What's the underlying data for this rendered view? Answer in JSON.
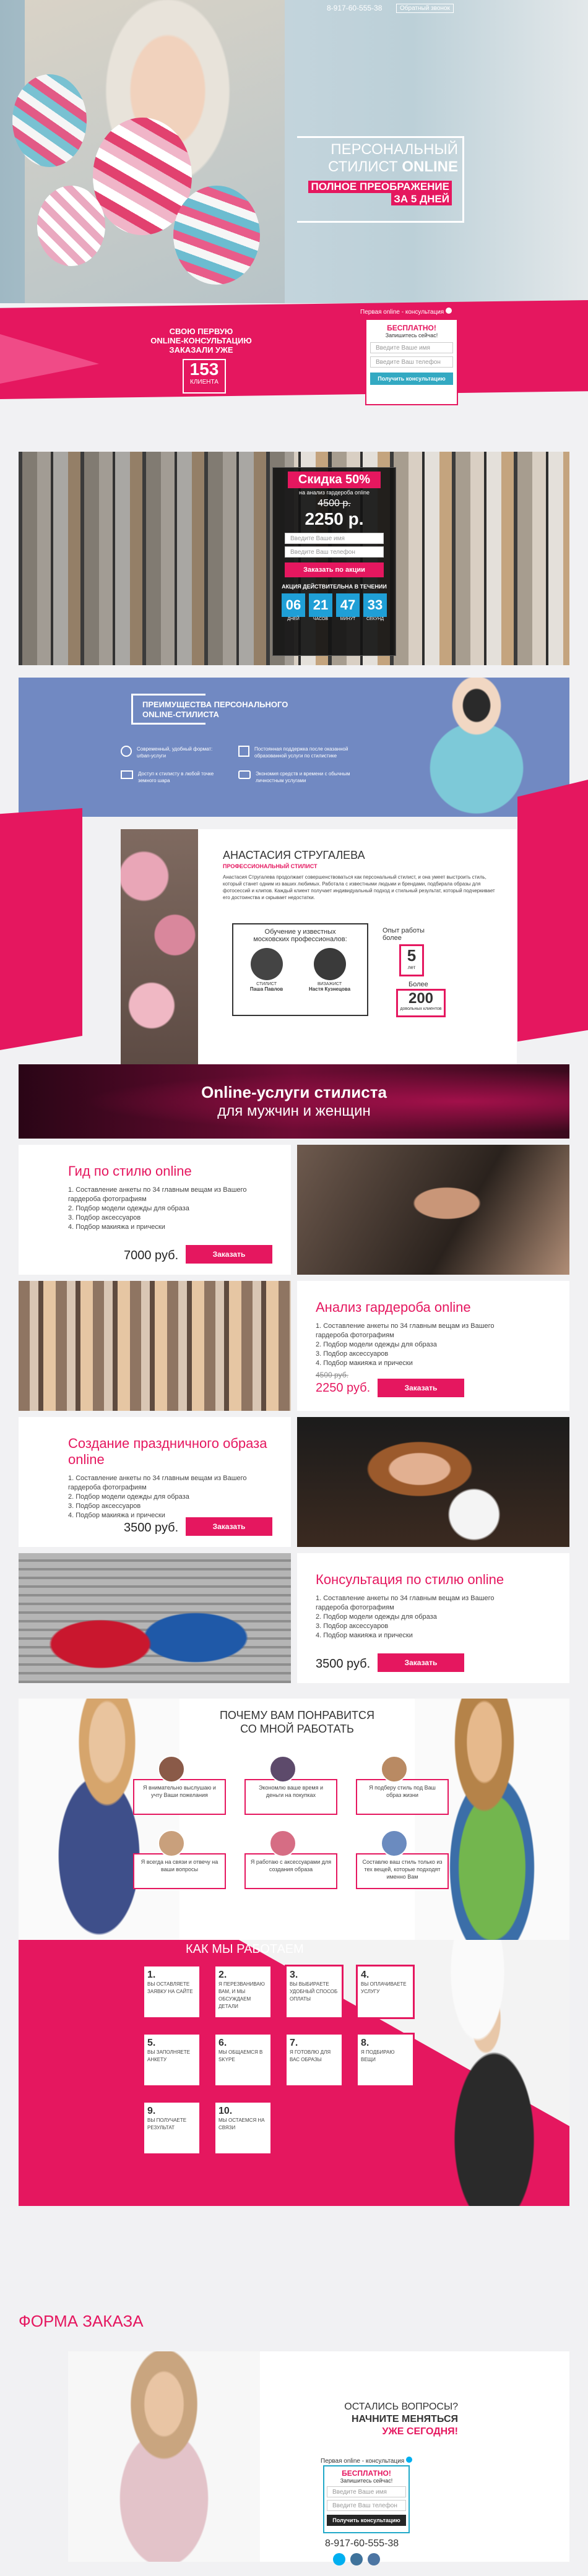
{
  "hero": {
    "phone": "8-917-60-555-38",
    "callback": "Обратный звонок",
    "title_line1": "ПЕРСОНАЛЬНЫЙ",
    "title_line2a": "СТИЛИСТ",
    "title_line2b": "ONLINE",
    "subtitle_line1": "ПОЛНОЕ ПРЕОБРАЖЕНИЕ",
    "subtitle_line2": "ЗА 5 ДНЕЙ",
    "counter_line1": "СВОЮ ПЕРВУЮ",
    "counter_line2": "ONLINE-КОНСУЛЬТАЦИЮ",
    "counter_line3": "ЗАКАЗАЛИ УЖЕ",
    "counter_value": "153",
    "counter_unit": "КЛИЕНТА",
    "form_caption": "Первая online - консультация",
    "form_title": "БЕСПЛАТНО!",
    "form_subtitle": "Запишитесь сейчас!",
    "name_placeholder": "Введите Ваше имя",
    "phone_placeholder": "Введите Ваш телефон",
    "submit": "Получить консультацию"
  },
  "promo": {
    "discount": "Скидка 50%",
    "discount_sub": "на анализ гардероба online",
    "old_price": "4500 р.",
    "new_price": "2250 р.",
    "name_placeholder": "Введите Ваше имя",
    "phone_placeholder": "Введите Ваш телефон",
    "submit": "Заказать по акции",
    "timer_title": "АКЦИЯ ДЕЙСТВИТЕЛЬНА В ТЕЧЕНИИ",
    "timer": [
      {
        "value": "06",
        "label": "ДНЕЙ"
      },
      {
        "value": "21",
        "label": "ЧАСОВ"
      },
      {
        "value": "47",
        "label": "МИНУТ"
      },
      {
        "value": "33",
        "label": "СЕКУНД"
      }
    ]
  },
  "benefits": {
    "title_line1": "ПРЕИМУЩЕСТВА ПЕРСОНАЛЬНОГО",
    "title_line2": "ONLINE-СТИЛИСТА",
    "items": [
      {
        "icon": "skype-icon",
        "text": "Современный, удобный формат: urban-услуги"
      },
      {
        "icon": "clock-icon",
        "text": "Постоянная поддержка после оказанной образованной услуги по стилистике"
      },
      {
        "icon": "laptop-icon",
        "text": "Доступ к стилисту в любой точке земного шара"
      },
      {
        "icon": "wallet-icon",
        "text": "Экономия средств и времени с обычным личностным услугами"
      }
    ]
  },
  "about": {
    "name": "АНАСТАСИЯ СТРУГАЛЕВА",
    "role": "ПРОФЕССИОНАЛЬНЫЙ СТИЛИСТ",
    "bio": "Анастасия Стругалева продолжает совершенствоваться как персональный стилист, и она умеет выстроить стиль, который станет одним из ваших любимых. Работала с известными людьми и брендами, подбирала образы для фотосессий и клипов. Каждый клиент получает индивидуальный подход и стильный результат, который подчеркивает его достоинства и скрывает недостатки.",
    "trained_title": "Обучение у известных",
    "trained_title2": "московских профессионалов:",
    "mentors": [
      {
        "role": "СТИЛИСТ",
        "name": "Паша Павлов"
      },
      {
        "role": "ВИЗАЖИСТ",
        "name": "Настя Кузнецова"
      }
    ],
    "exp_title": "Опыт работы",
    "exp_title2": "более",
    "exp_value": "5",
    "exp_unit": "лет",
    "clients_title": "Более",
    "clients_value": "200",
    "clients_unit": "довольных клиентов"
  },
  "services": {
    "title": "Online-услуги стилиста",
    "subtitle": "для мужчин и женщин",
    "order": "Заказать",
    "items": [
      {
        "title": "Гид по стилю online",
        "price": "7000 руб.",
        "old": ""
      },
      {
        "title": "Анализ гардероба online",
        "price": "2250 руб.",
        "old": "4500 руб."
      },
      {
        "title": "Создание праздничного образа online",
        "price": "3500 руб.",
        "old": ""
      },
      {
        "title": "Консультация по стилю online",
        "price": "3500 руб.",
        "old": ""
      }
    ],
    "desc": "1. Составление анкеты по 34 главным вещам из Вашего гардероба фотографиям\n2. Подбор модели одежды для образа\n3. Подбор аксессуаров\n4. Подбор макияжа и прически"
  },
  "why": {
    "title_line1": "ПОЧЕМУ ВАМ ПОНРАВИТСЯ",
    "title_line2": "СО МНОЙ РАБОТАТЬ",
    "items": [
      "Я внимательно выслушаю и учту Ваши пожелания",
      "Экономлю ваше время и деньги на покупках",
      "Я подберу стиль под Ваш образ жизни",
      "Я всегда на связи и отвечу на ваши вопросы",
      "Я работаю с аксессуарами для создания образа",
      "Составлю ваш стиль только из тех вещей, которые подходят именно Вам"
    ]
  },
  "steps": {
    "title": "КАК МЫ РАБОТАЕМ",
    "items": [
      {
        "n": "1.",
        "text": "ВЫ ОСТАВЛЯЕТЕ ЗАЯВКУ НА САЙТЕ"
      },
      {
        "n": "2.",
        "text": "Я ПЕРЕЗВАНИВАЮ ВАМ, И МЫ ОБСУЖДАЕМ ДЕТАЛИ"
      },
      {
        "n": "3.",
        "text": "ВЫ ВЫБИРАЕТЕ УДОБНЫЙ СПОСОБ ОПЛАТЫ"
      },
      {
        "n": "4.",
        "text": "ВЫ ОПЛАЧИВАЕТЕ УСЛУГУ"
      },
      {
        "n": "5.",
        "text": "ВЫ ЗАПОЛНЯЕТЕ АНКЕТУ"
      },
      {
        "n": "6.",
        "text": "МЫ ОБЩАЕМСЯ В SKYPE"
      },
      {
        "n": "7.",
        "text": "Я ГОТОВЛЮ ДЛЯ ВАС ОБРАЗЫ"
      },
      {
        "n": "8.",
        "text": "Я ПОДБИРАЮ ВЕЩИ"
      },
      {
        "n": "9.",
        "text": "ВЫ ПОЛУЧАЕТЕ РЕЗУЛЬТАТ"
      },
      {
        "n": "10.",
        "text": "МЫ ОСТАЕМСЯ НА СВЯЗИ"
      }
    ]
  },
  "order": {
    "title": "ФОРМА ЗАКАЗА",
    "q1": "ОСТАЛИСЬ ВОПРОСЫ?",
    "q2": "НАЧНИТЕ МЕНЯТЬСЯ",
    "q3": "УЖЕ СЕГОДНЯ!",
    "form_caption": "Первая online - консультация",
    "form_title": "БЕСПЛАТНО!",
    "form_subtitle": "Запишитесь сейчас!",
    "name_placeholder": "Введите Ваше имя",
    "phone_placeholder": "Введите Ваш телефон",
    "submit": "Получить консультацию",
    "phone": "8-917-60-555-38"
  },
  "colors": {
    "accent": "#e5175f",
    "dark": "#262626",
    "blue": "#7189c2"
  }
}
